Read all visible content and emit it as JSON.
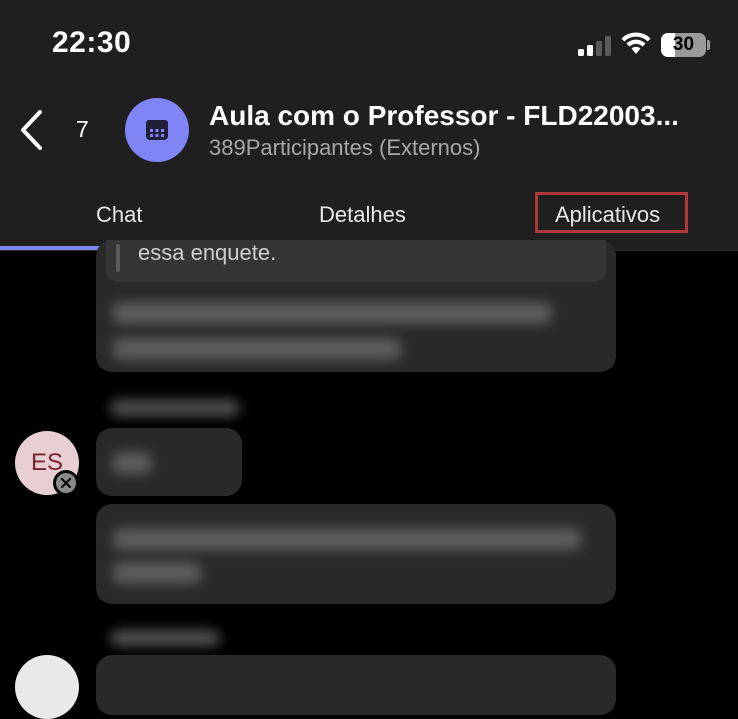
{
  "status_bar": {
    "time": "22:30",
    "battery_level": "30",
    "signal_bars_active": 2,
    "signal_bars_total": 4,
    "battery_fraction": 0.3
  },
  "header": {
    "back_count": "7",
    "avatar_icon": "calendar-icon",
    "title": "Aula com o Professor - FLD22003...",
    "subtitle": "389Participantes (Externos)"
  },
  "tabs": [
    {
      "label": "Chat",
      "selected": true
    },
    {
      "label": "Detalhes",
      "selected": false
    },
    {
      "label": "Aplicativos",
      "selected": false,
      "highlighted": true
    }
  ],
  "messages": {
    "quoted_text": "essa enquete.",
    "sender_initials": "ES"
  },
  "colors": {
    "accent": "#7f85f5",
    "highlight_box": "#b0373a",
    "background": "#000000",
    "header_bg": "#1f1f1f",
    "bubble_bg": "#292929"
  }
}
